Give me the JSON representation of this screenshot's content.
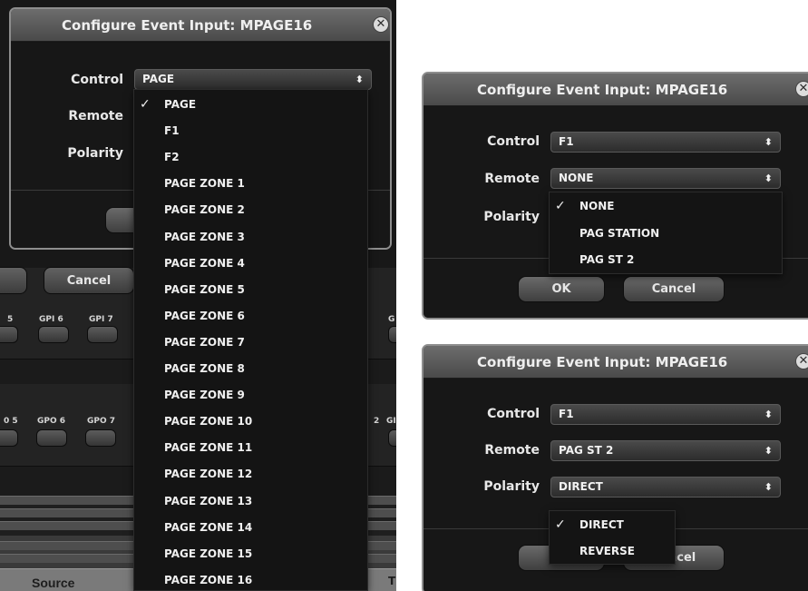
{
  "background_app": {
    "cancel_label": "Cancel",
    "gpi_labels": [
      "5",
      "GPI 6",
      "GPI 7",
      "G"
    ],
    "gpo_labels": [
      "0 5",
      "GPO 6",
      "GPO 7",
      "2",
      "GI"
    ],
    "source_header": "Source",
    "t_header": "T"
  },
  "dialogs": [
    {
      "title": "Configure Event Input: MPAGE16",
      "fields": [
        {
          "label": "Control",
          "value": "PAGE"
        },
        {
          "label": "Remote",
          "value": ""
        },
        {
          "label": "Polarity",
          "value": ""
        }
      ],
      "ok_label": "",
      "cancel_label": "",
      "open_menu": {
        "field": "Control",
        "selected": "PAGE",
        "options": [
          "PAGE",
          "F1",
          "F2",
          "PAGE ZONE 1",
          "PAGE ZONE 2",
          "PAGE ZONE 3",
          "PAGE ZONE 4",
          "PAGE ZONE 5",
          "PAGE ZONE 6",
          "PAGE ZONE 7",
          "PAGE ZONE 8",
          "PAGE ZONE 9",
          "PAGE ZONE 10",
          "PAGE ZONE 11",
          "PAGE ZONE 12",
          "PAGE ZONE 13",
          "PAGE ZONE 14",
          "PAGE ZONE 15",
          "PAGE ZONE 16"
        ]
      }
    },
    {
      "title": "Configure Event Input: MPAGE16",
      "fields": [
        {
          "label": "Control",
          "value": "F1"
        },
        {
          "label": "Remote",
          "value": "NONE"
        },
        {
          "label": "Polarity",
          "value": ""
        }
      ],
      "ok_label": "OK",
      "cancel_label": "Cancel",
      "open_menu": {
        "field": "Remote",
        "selected": "NONE",
        "options": [
          "NONE",
          "PAG STATION",
          "PAG ST 2"
        ]
      }
    },
    {
      "title": "Configure Event Input: MPAGE16",
      "fields": [
        {
          "label": "Control",
          "value": "F1"
        },
        {
          "label": "Remote",
          "value": "PAG ST 2"
        },
        {
          "label": "Polarity",
          "value": "DIRECT"
        }
      ],
      "ok_label": "OK",
      "cancel_label": "Cancel",
      "open_menu": {
        "field": "Polarity",
        "selected": "DIRECT",
        "options": [
          "DIRECT",
          "REVERSE"
        ]
      }
    }
  ],
  "icons": {
    "close": "close-icon",
    "select_arrow": "up-down-chevron-icon",
    "check": "checkmark-icon"
  },
  "colors": {
    "dialog_body": "#171717",
    "titlebar": "#5a5a5a",
    "text": "#f0f0f0"
  }
}
